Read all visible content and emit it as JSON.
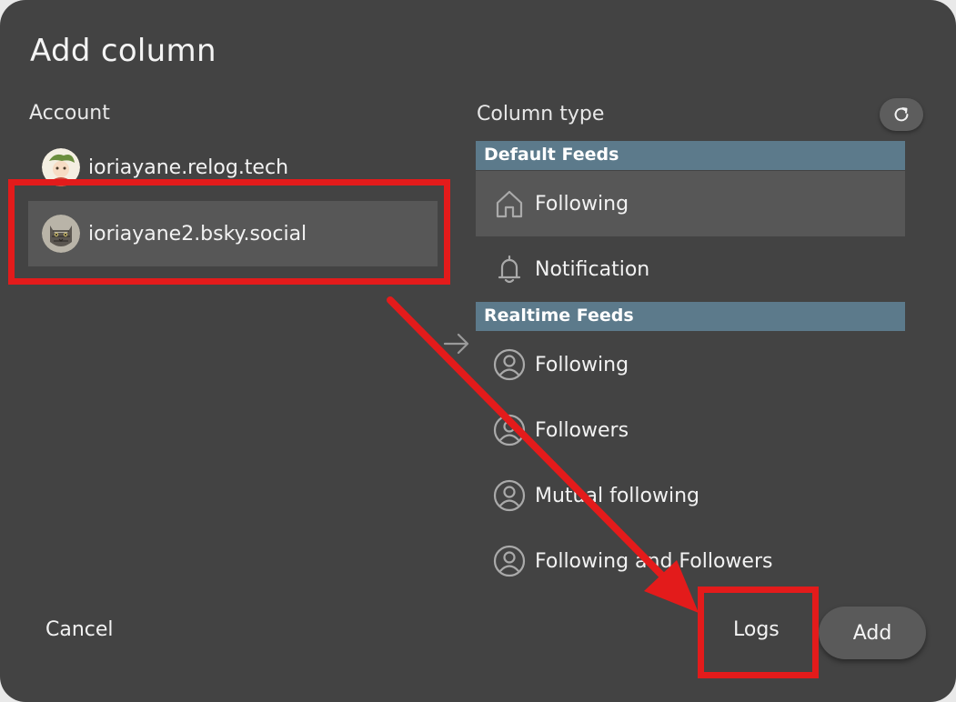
{
  "dialog": {
    "title": "Add column"
  },
  "account_section": {
    "label": "Account",
    "accounts": [
      {
        "handle": "ioriayane.relog.tech",
        "selected": false
      },
      {
        "handle": "ioriayane2.bsky.social",
        "selected": true
      }
    ]
  },
  "column_type_section": {
    "label": "Column type",
    "groups": [
      {
        "name": "Default Feeds",
        "items": [
          {
            "label": "Following",
            "icon": "home-icon",
            "selected": true
          },
          {
            "label": "Notification",
            "icon": "bell-icon",
            "selected": false
          }
        ]
      },
      {
        "name": "Realtime Feeds",
        "items": [
          {
            "label": "Following",
            "icon": "user-circle-icon",
            "selected": false
          },
          {
            "label": "Followers",
            "icon": "user-circle-icon",
            "selected": false
          },
          {
            "label": "Mutual following",
            "icon": "user-circle-icon",
            "selected": false
          },
          {
            "label": "Following and Followers",
            "icon": "user-circle-icon",
            "selected": false
          }
        ]
      }
    ]
  },
  "footer": {
    "cancel_label": "Cancel",
    "logs_label": "Logs",
    "add_label": "Add"
  },
  "colors": {
    "dialog_bg": "#434343",
    "selected_row": "#575757",
    "group_header": "#5c7a8b",
    "annotation": "#e31b1b"
  }
}
